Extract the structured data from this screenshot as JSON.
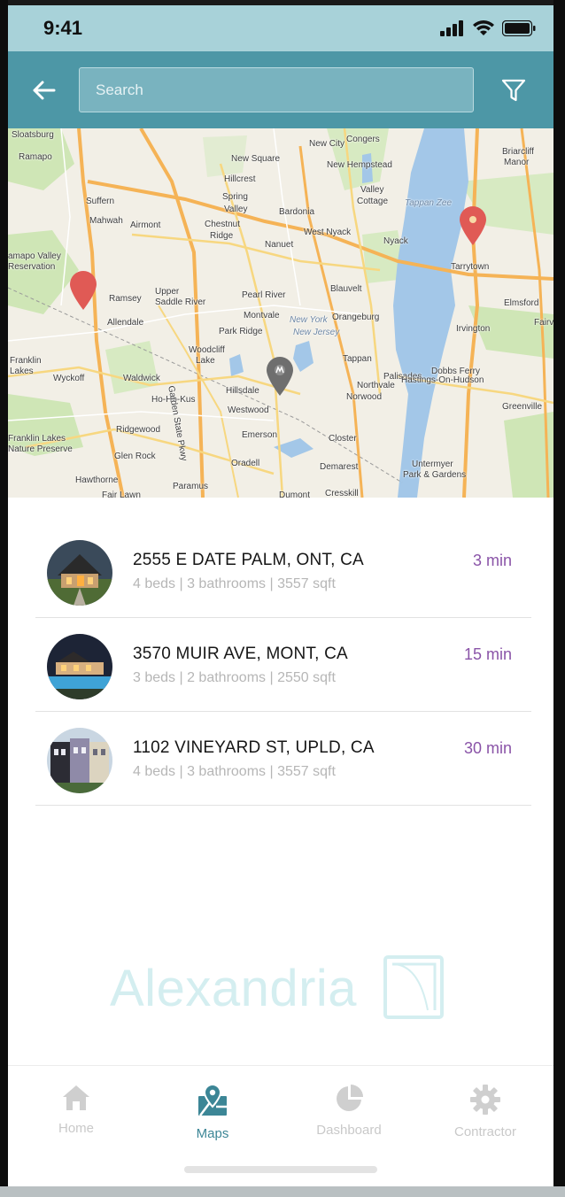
{
  "status_bar": {
    "time": "9:41"
  },
  "header": {
    "search_placeholder": "Search",
    "back_icon": "arrow-left-icon",
    "filter_icon": "funnel-icon"
  },
  "map": {
    "labels": [
      "Sloatsburg",
      "Ramapo",
      "Suffern",
      "Mahwah",
      "amapo Valley",
      "Reservation",
      "Airmont",
      "Spring",
      "Valley",
      "Hillcrest",
      "New Square",
      "New City",
      "Congers",
      "New Hempstead",
      "Valley",
      "Cottage",
      "Bardonia",
      "Chestnut",
      "Ridge",
      "Nanuet",
      "West Nyack",
      "Nyack",
      "Tappan Zee",
      "Briarcliff",
      "Manor",
      "Tarrytown",
      "Ramsey",
      "Upper",
      "Saddle River",
      "Allendale",
      "Pearl River",
      "Blauvelt",
      "Montvale",
      "Orangeburg",
      "Park Ridge",
      "Irvington",
      "Elmsford",
      "Fairv",
      "Woodcliff",
      "Lake",
      "Franklin",
      "Lakes",
      "Wyckoff",
      "Waldwick",
      "Ho-Ho-Kus",
      "Hillsdale",
      "Westwood",
      "Northvale",
      "Norwood",
      "Tappan",
      "Palisades",
      "Dobbs Ferry",
      "Hastings-On-Hudson",
      "Greenville",
      "Ridgewood",
      "Emerson",
      "Closter",
      "Franklin Lakes",
      "Nature Preserve",
      "Glen Rock",
      "Oradell",
      "Demarest",
      "Hawthorne",
      "Paramus",
      "Fair Lawn",
      "Dumont",
      "Cresskill",
      "Untermyer",
      "Park & Gardens",
      "New York",
      "New Jersey",
      "Garden State Pkwy"
    ]
  },
  "listings": [
    {
      "address": "2555 E DATE PALM, ONT, CA",
      "details": "4 beds | 3 bathrooms | 3557 sqft",
      "eta": "3 min"
    },
    {
      "address": "3570 MUIR AVE, MONT, CA",
      "details": "3 beds | 2 bathrooms | 2550 sqft",
      "eta": "15 min"
    },
    {
      "address": "1102 VINEYARD ST, UPLD, CA",
      "details": "4 beds | 3 bathrooms | 3557 sqft",
      "eta": "30 min"
    }
  ],
  "watermark": {
    "text": "Alexandria"
  },
  "tabs": [
    {
      "label": "Home",
      "icon": "home-icon"
    },
    {
      "label": "Maps",
      "icon": "map-pin-icon"
    },
    {
      "label": "Dashboard",
      "icon": "pie-chart-icon"
    },
    {
      "label": "Contractor",
      "icon": "gear-icon"
    }
  ],
  "colors": {
    "header": "#4d97a6",
    "status_bar": "#a8d2d9",
    "eta": "#8a54a8",
    "active_tab": "#3c8696",
    "pin_red": "#e05a55",
    "pin_gray": "#6e6e6e"
  }
}
